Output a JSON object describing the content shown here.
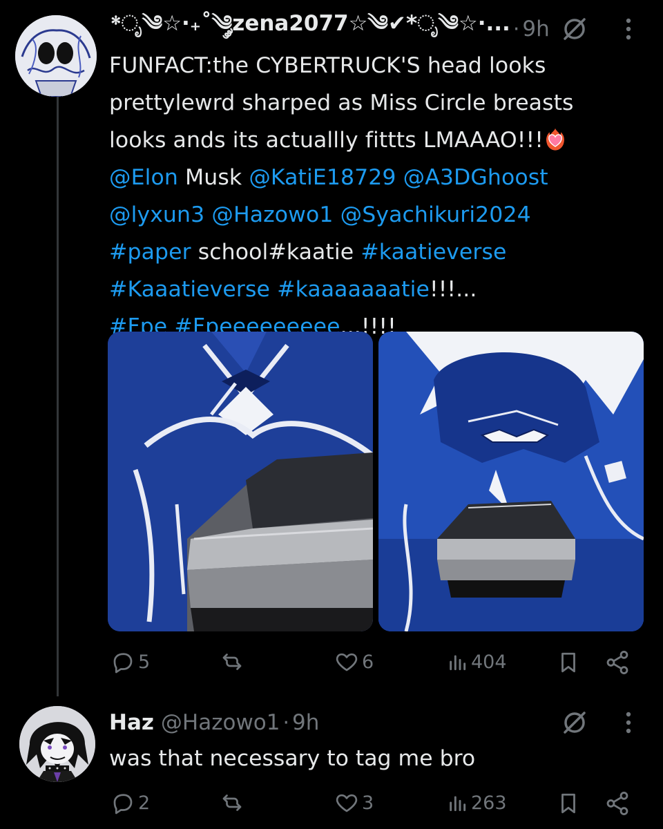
{
  "post1": {
    "display_name": "*ೃ༄☆·₊˚༄༘zena2077☆༄✔*ೃ༄☆·...",
    "separator": "·",
    "time": "9h",
    "text_lines": [
      [
        {
          "t": "FUNFACT:the CYBERTRUCK'S head looks",
          "link": false
        }
      ],
      [
        {
          "t": "prettylewrd sharped as Miss Circle breasts",
          "link": false
        }
      ],
      [
        {
          "t": "looks ands its actuallly fittts LMAAAO!!!",
          "link": false
        }
      ],
      [
        {
          "t": "@Elon",
          "link": true
        },
        {
          "t": " Musk ",
          "link": false
        },
        {
          "t": "@KatiE18729",
          "link": true
        },
        {
          "t": " ",
          "link": false
        },
        {
          "t": "@A3DGhoost",
          "link": true
        }
      ],
      [
        {
          "t": "@lyxun3",
          "link": true
        },
        {
          "t": " ",
          "link": false
        },
        {
          "t": "@Hazowo1",
          "link": true
        },
        {
          "t": " ",
          "link": false
        },
        {
          "t": "@Syachikuri2024",
          "link": true
        }
      ],
      [
        {
          "t": "#paper",
          "link": true
        },
        {
          "t": " school#kaatie ",
          "link": false
        },
        {
          "t": "#kaatieverse",
          "link": true
        }
      ],
      [
        {
          "t": "#Kaaatieverse",
          "link": true
        },
        {
          "t": " ",
          "link": false
        },
        {
          "t": "#kaaaaaaatie",
          "link": true
        },
        {
          "t": "!!!...",
          "link": false
        }
      ],
      [
        {
          "t": "#Fpe",
          "link": true
        },
        {
          "t": " ",
          "link": false
        },
        {
          "t": "#Fpeeeeeeeee",
          "link": true
        },
        {
          "t": "...!!!!",
          "link": false
        }
      ]
    ],
    "emoji": "heart-on-fire",
    "media": [
      {
        "name": "cybertruck-over-character-image"
      },
      {
        "name": "character-with-cybertruck-image"
      }
    ],
    "actions": {
      "replies": "5",
      "reposts": "",
      "likes": "6",
      "views": "404"
    }
  },
  "post2": {
    "display_name": "Haz",
    "handle": "@Hazowo1",
    "separator": "·",
    "time": "9h",
    "text": "was that necessary to tag me bro",
    "actions": {
      "replies": "2",
      "reposts": "",
      "likes": "3",
      "views": "263"
    }
  },
  "colors": {
    "background": "#000000",
    "text": "#e7e9ea",
    "muted": "#71767b",
    "link": "#1d9bf0",
    "thread_line": "#333639"
  }
}
